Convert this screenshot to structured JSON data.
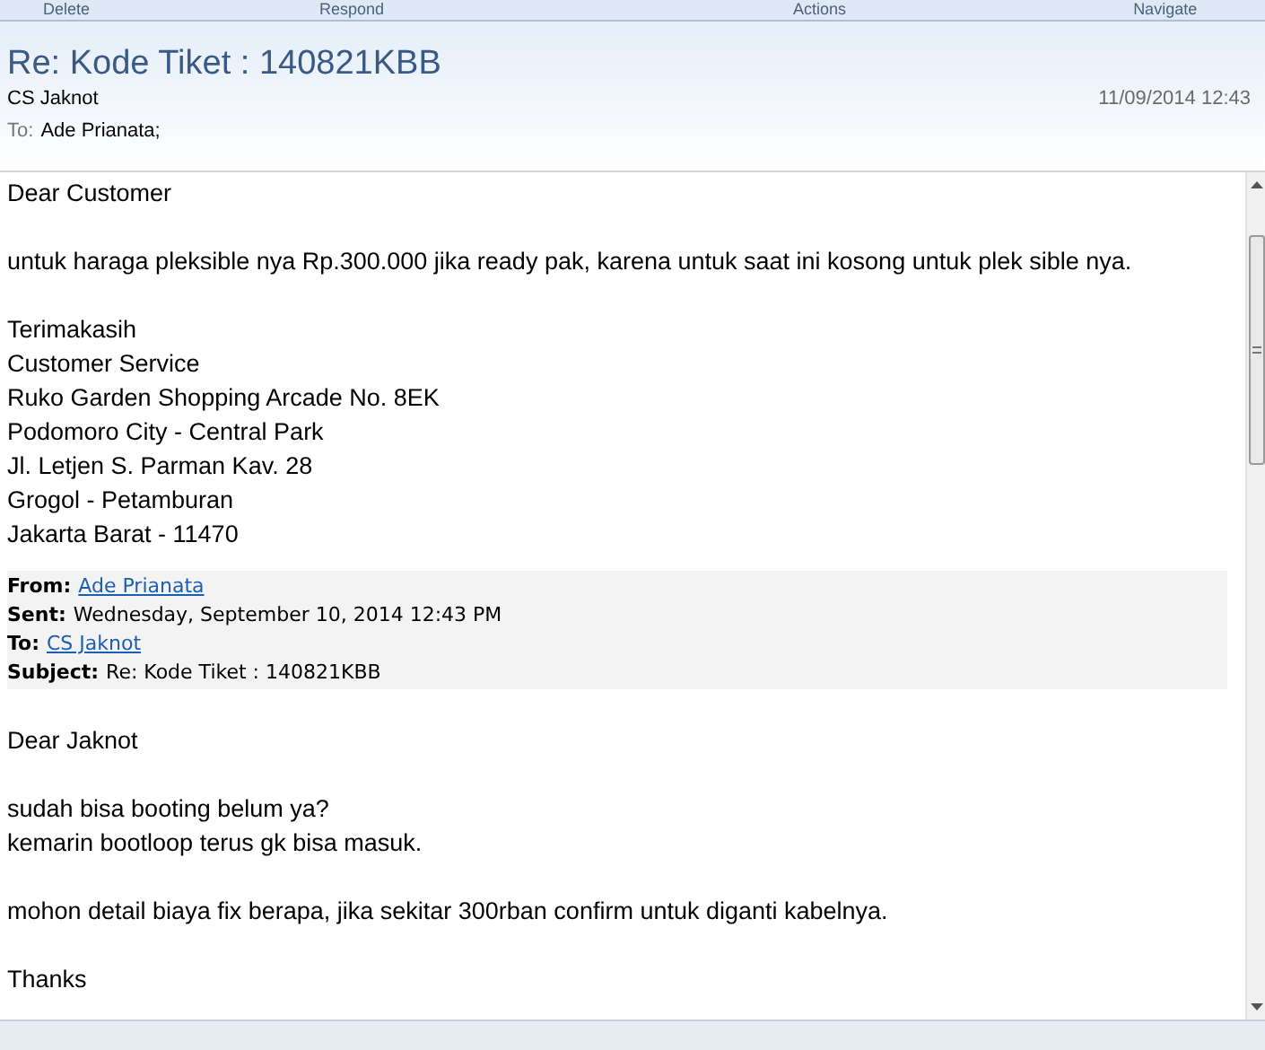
{
  "ribbon_groups": [
    "Delete",
    "Respond",
    "Actions",
    "Navigate"
  ],
  "message": {
    "subject": "Re: Kode Tiket : 140821KBB",
    "sender": "CS Jaknot",
    "date": "11/09/2014 12:43",
    "to_label": "To:",
    "to": "Ade Prianata;"
  },
  "body": [
    [
      "Dear Customer"
    ],
    [
      "untuk haraga pleksible nya Rp.300.000 jika ready pak, karena untuk saat ini kosong untuk plek sible nya."
    ],
    [
      "Terimakasih",
      "Customer Service",
      "Ruko Garden Shopping Arcade No. 8EK",
      "Podomoro City - Central Park",
      "Jl. Letjen S. Parman Kav. 28",
      "Grogol - Petamburan",
      "Jakarta Barat - 11470"
    ]
  ],
  "quoted_header": [
    {
      "label": "From:",
      "value": "Ade Prianata",
      "kind": "link"
    },
    {
      "label": "Sent:",
      "value": "Wednesday, September 10, 2014 12:43 PM",
      "kind": "text"
    },
    {
      "label": "To:",
      "value": "CS Jaknot",
      "kind": "link"
    },
    {
      "label": "Subject:",
      "value": "Re: Kode Tiket : 140821KBB",
      "kind": "text"
    }
  ],
  "quoted_body": [
    [
      "Dear Jaknot"
    ],
    [
      "sudah bisa booting belum ya?",
      "kemarin bootloop terus gk bisa masuk."
    ],
    [
      "mohon detail biaya fix berapa, jika sekitar 300rban confirm untuk diganti kabelnya."
    ],
    [
      "Thanks"
    ]
  ]
}
